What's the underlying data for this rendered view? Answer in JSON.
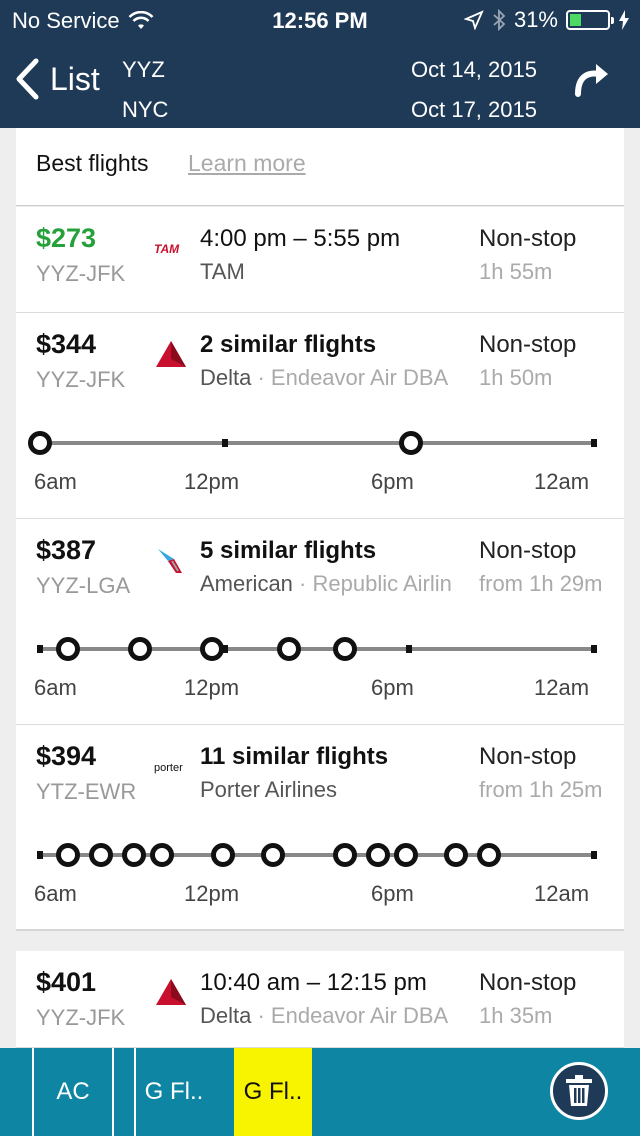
{
  "status_bar": {
    "carrier": "No Service",
    "time": "12:56 PM",
    "battery": "31%",
    "battery_level": 0.31
  },
  "header": {
    "back_label": "List",
    "origin": "YYZ",
    "destination": "NYC",
    "depart_date": "Oct 14, 2015",
    "return_date": "Oct 17, 2015"
  },
  "best": {
    "title": "Best flights",
    "learn_more": "Learn more"
  },
  "timeline_labels": [
    "6am",
    "12pm",
    "6pm",
    "12am"
  ],
  "flights": [
    {
      "price": "$273",
      "route": "YYZ-JFK",
      "logo": "tam-logo",
      "logo_text": "TAM",
      "main": "4:00 pm – 5:55 pm",
      "airline": "TAM",
      "operator": "",
      "stops": "Non-stop",
      "duration": "1h 55m"
    },
    {
      "price": "$344",
      "route": "YYZ-JFK",
      "logo": "delta-logo",
      "main": "2 similar flights",
      "airline": "Delta",
      "operator": "· Endeavor Air DBA",
      "stops": "Non-stop",
      "duration": "1h 50m",
      "departures": [
        0.0,
        0.67
      ]
    },
    {
      "price": "$387",
      "route": "YYZ-LGA",
      "logo": "american-logo",
      "main": "5 similar flights",
      "airline": "American",
      "operator": "· Republic Airlin",
      "stops": "Non-stop",
      "duration": "from 1h 29m",
      "departures": [
        0.05,
        0.18,
        0.31,
        0.45,
        0.55
      ]
    },
    {
      "price": "$394",
      "route": "YTZ-EWR",
      "logo": "porter-logo",
      "logo_text": "porter",
      "main": "11 similar flights",
      "airline": "Porter Airlines",
      "operator": "",
      "stops": "Non-stop",
      "duration": "from 1h 25m",
      "departures": [
        0.05,
        0.11,
        0.17,
        0.22,
        0.33,
        0.42,
        0.55,
        0.61,
        0.66,
        0.75,
        0.81
      ]
    },
    {
      "price": "$401",
      "route": "YYZ-JFK",
      "logo": "delta-logo",
      "main": "10:40 am – 12:15 pm",
      "airline": "Delta",
      "operator": "· Endeavor Air DBA",
      "stops": "Non-stop",
      "duration": "1h 35m"
    }
  ],
  "tabs": [
    "AC",
    "",
    "G Fl..",
    "G Fl.."
  ],
  "colors": {
    "header": "#1f3a57",
    "price_best": "#26a03a",
    "tabbar": "#0e86a3",
    "tab_active": "#f8f400"
  }
}
